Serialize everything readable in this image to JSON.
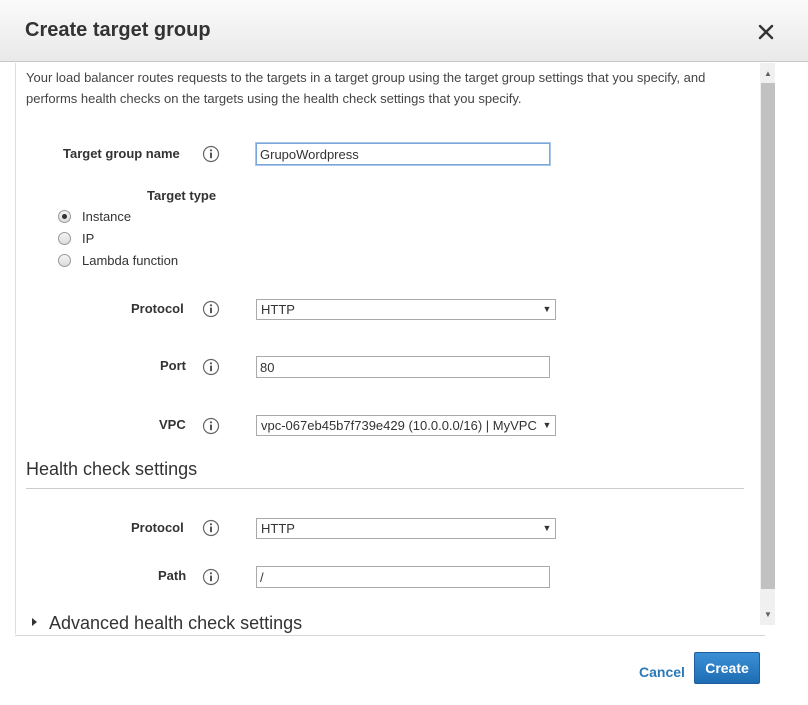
{
  "modal": {
    "title": "Create target group",
    "close_icon": "close-icon"
  },
  "intro_text": "Your load balancer routes requests to the targets in a target group using the target group settings that you specify, and performs health checks on the targets using the health check settings that you specify.",
  "target_group_name": {
    "label": "Target group name",
    "value": "GrupoWordpress",
    "info_icon": "info-icon"
  },
  "target_type": {
    "label": "Target type",
    "options": [
      {
        "label": "Instance",
        "checked": true
      },
      {
        "label": "IP",
        "checked": false
      },
      {
        "label": "Lambda function",
        "checked": false
      }
    ]
  },
  "protocol": {
    "label": "Protocol",
    "value": "HTTP"
  },
  "port": {
    "label": "Port",
    "value": "80"
  },
  "vpc": {
    "label": "VPC",
    "value": "vpc-067eb45b7f739e429 (10.0.0.0/16) | MyVPC"
  },
  "health_check": {
    "section_title": "Health check settings",
    "protocol_label": "Protocol",
    "protocol_value": "HTTP",
    "path_label": "Path",
    "path_value": "/",
    "advanced_label": "Advanced health check settings"
  },
  "footer": {
    "cancel_label": "Cancel",
    "create_label": "Create"
  },
  "colors": {
    "primary_button": "#1e6db3",
    "link": "#2a7ab8",
    "header_bg": "#efefef"
  }
}
